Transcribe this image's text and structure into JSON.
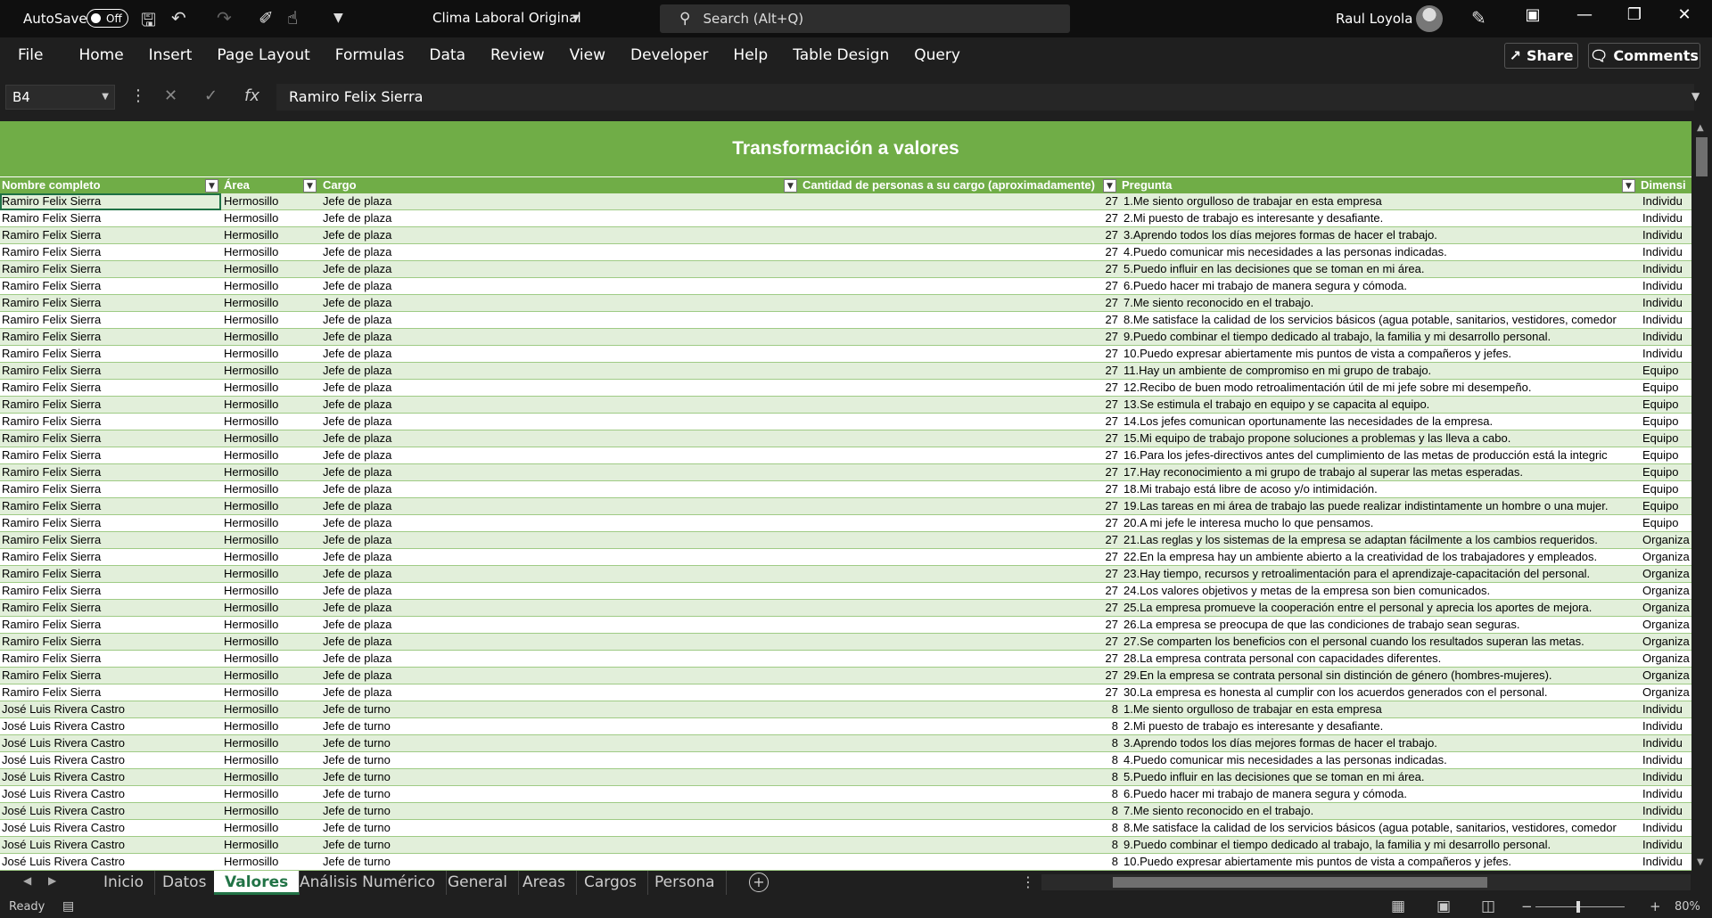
{
  "titlebar": {
    "autosave_label": "AutoSave",
    "autosave_state": "Off",
    "doc_title": "Clima Laboral Original",
    "search_placeholder": "Search (Alt+Q)",
    "user_name": "Raul Loyola"
  },
  "menu": [
    "File",
    "Home",
    "Insert",
    "Page Layout",
    "Formulas",
    "Data",
    "Review",
    "View",
    "Developer",
    "Help",
    "Table Design",
    "Query"
  ],
  "share_label": "Share",
  "comments_label": "Comments",
  "formula": {
    "cell_ref": "B4",
    "content": "Ramiro Felix Sierra"
  },
  "sheet": {
    "title": "Transformación a valores",
    "headers": [
      "Nombre completo",
      "Área",
      "Cargo",
      "Cantidad de personas a su cargo (aproximadamente)",
      "Pregunta",
      "Dimensi"
    ],
    "rows": [
      [
        "Ramiro Felix Sierra",
        "Hermosillo",
        "Jefe de plaza",
        "27",
        "1.Me siento orgulloso de trabajar en esta empresa",
        "Individu"
      ],
      [
        "Ramiro Felix Sierra",
        "Hermosillo",
        "Jefe de plaza",
        "27",
        "2.Mi puesto de trabajo es interesante y desafiante.",
        "Individu"
      ],
      [
        "Ramiro Felix Sierra",
        "Hermosillo",
        "Jefe de plaza",
        "27",
        "3.Aprendo todos los días mejores formas de hacer el trabajo.",
        "Individu"
      ],
      [
        "Ramiro Felix Sierra",
        "Hermosillo",
        "Jefe de plaza",
        "27",
        "4.Puedo comunicar mis necesidades a las personas indicadas.",
        "Individu"
      ],
      [
        "Ramiro Felix Sierra",
        "Hermosillo",
        "Jefe de plaza",
        "27",
        "5.Puedo influir en las decisiones que se toman en mi área.",
        "Individu"
      ],
      [
        "Ramiro Felix Sierra",
        "Hermosillo",
        "Jefe de plaza",
        "27",
        "6.Puedo hacer mi trabajo de manera segura y cómoda.",
        "Individu"
      ],
      [
        "Ramiro Felix Sierra",
        "Hermosillo",
        "Jefe de plaza",
        "27",
        "7.Me siento reconocido en el trabajo.",
        "Individu"
      ],
      [
        "Ramiro Felix Sierra",
        "Hermosillo",
        "Jefe de plaza",
        "27",
        "8.Me satisface la calidad de los servicios básicos (agua potable, sanitarios, vestidores, comedor",
        "Individu"
      ],
      [
        "Ramiro Felix Sierra",
        "Hermosillo",
        "Jefe de plaza",
        "27",
        "9.Puedo combinar el tiempo dedicado al trabajo, la familia y mi desarrollo personal.",
        "Individu"
      ],
      [
        "Ramiro Felix Sierra",
        "Hermosillo",
        "Jefe de plaza",
        "27",
        "10.Puedo expresar abiertamente mis puntos de vista a compañeros y jefes.",
        "Individu"
      ],
      [
        "Ramiro Felix Sierra",
        "Hermosillo",
        "Jefe de plaza",
        "27",
        "11.Hay un ambiente de compromiso en mi grupo de trabajo.",
        "Equipo"
      ],
      [
        "Ramiro Felix Sierra",
        "Hermosillo",
        "Jefe de plaza",
        "27",
        "12.Recibo de buen modo retroalimentación útil de mi jefe sobre mi desempeño.",
        "Equipo"
      ],
      [
        "Ramiro Felix Sierra",
        "Hermosillo",
        "Jefe de plaza",
        "27",
        "13.Se estimula el trabajo en equipo y se capacita al equipo.",
        "Equipo"
      ],
      [
        "Ramiro Felix Sierra",
        "Hermosillo",
        "Jefe de plaza",
        "27",
        "14.Los jefes comunican oportunamente las necesidades de la empresa.",
        "Equipo"
      ],
      [
        "Ramiro Felix Sierra",
        "Hermosillo",
        "Jefe de plaza",
        "27",
        "15.Mi equipo de trabajo propone soluciones a problemas y las lleva a cabo.",
        "Equipo"
      ],
      [
        "Ramiro Felix Sierra",
        "Hermosillo",
        "Jefe de plaza",
        "27",
        "16.Para los jefes-directivos antes del cumplimiento de las metas de producción está la integric",
        "Equipo"
      ],
      [
        "Ramiro Felix Sierra",
        "Hermosillo",
        "Jefe de plaza",
        "27",
        "17.Hay reconocimiento a mi grupo de trabajo al superar las metas esperadas.",
        "Equipo"
      ],
      [
        "Ramiro Felix Sierra",
        "Hermosillo",
        "Jefe de plaza",
        "27",
        "18.Mi trabajo está libre de acoso y/o intimidación.",
        "Equipo"
      ],
      [
        "Ramiro Felix Sierra",
        "Hermosillo",
        "Jefe de plaza",
        "27",
        "19.Las tareas en mi área de trabajo las puede realizar indistintamente un hombre o una mujer.",
        "Equipo"
      ],
      [
        "Ramiro Felix Sierra",
        "Hermosillo",
        "Jefe de plaza",
        "27",
        "20.A mi jefe le interesa mucho lo que pensamos.",
        "Equipo"
      ],
      [
        "Ramiro Felix Sierra",
        "Hermosillo",
        "Jefe de plaza",
        "27",
        "21.Las reglas y los sistemas de la empresa se adaptan fácilmente a los cambios requeridos.",
        "Organiza"
      ],
      [
        "Ramiro Felix Sierra",
        "Hermosillo",
        "Jefe de plaza",
        "27",
        "22.En la empresa hay un ambiente abierto a la creatividad de los trabajadores y empleados.",
        "Organiza"
      ],
      [
        "Ramiro Felix Sierra",
        "Hermosillo",
        "Jefe de plaza",
        "27",
        "23.Hay tiempo, recursos y retroalimentación para el aprendizaje-capacitación del personal.",
        "Organiza"
      ],
      [
        "Ramiro Felix Sierra",
        "Hermosillo",
        "Jefe de plaza",
        "27",
        "24.Los valores objetivos y metas de la empresa son bien comunicados.",
        "Organiza"
      ],
      [
        "Ramiro Felix Sierra",
        "Hermosillo",
        "Jefe de plaza",
        "27",
        "25.La empresa promueve la cooperación entre el personal y aprecia los aportes de mejora.",
        "Organiza"
      ],
      [
        "Ramiro Felix Sierra",
        "Hermosillo",
        "Jefe de plaza",
        "27",
        "26.La empresa se preocupa de que las condiciones de trabajo sean seguras.",
        "Organiza"
      ],
      [
        "Ramiro Felix Sierra",
        "Hermosillo",
        "Jefe de plaza",
        "27",
        "27.Se comparten los beneficios con el personal cuando los resultados superan las metas.",
        "Organiza"
      ],
      [
        "Ramiro Felix Sierra",
        "Hermosillo",
        "Jefe de plaza",
        "27",
        "28.La empresa contrata personal con capacidades diferentes.",
        "Organiza"
      ],
      [
        "Ramiro Felix Sierra",
        "Hermosillo",
        "Jefe de plaza",
        "27",
        "29.En la empresa se contrata personal sin distinción de género (hombres-mujeres).",
        "Organiza"
      ],
      [
        "Ramiro Felix Sierra",
        "Hermosillo",
        "Jefe de plaza",
        "27",
        "30.La empresa es honesta al cumplir con los acuerdos generados con el personal.",
        "Organiza"
      ],
      [
        "José Luis Rivera Castro",
        "Hermosillo",
        "Jefe de turno",
        "8",
        "1.Me siento orgulloso de trabajar en esta empresa",
        "Individu"
      ],
      [
        "José Luis Rivera Castro",
        "Hermosillo",
        "Jefe de turno",
        "8",
        "2.Mi puesto de trabajo es interesante y desafiante.",
        "Individu"
      ],
      [
        "José Luis Rivera Castro",
        "Hermosillo",
        "Jefe de turno",
        "8",
        "3.Aprendo todos los días mejores formas de hacer el trabajo.",
        "Individu"
      ],
      [
        "José Luis Rivera Castro",
        "Hermosillo",
        "Jefe de turno",
        "8",
        "4.Puedo comunicar mis necesidades a las personas indicadas.",
        "Individu"
      ],
      [
        "José Luis Rivera Castro",
        "Hermosillo",
        "Jefe de turno",
        "8",
        "5.Puedo influir en las decisiones que se toman en mi área.",
        "Individu"
      ],
      [
        "José Luis Rivera Castro",
        "Hermosillo",
        "Jefe de turno",
        "8",
        "6.Puedo hacer mi trabajo de manera segura y cómoda.",
        "Individu"
      ],
      [
        "José Luis Rivera Castro",
        "Hermosillo",
        "Jefe de turno",
        "8",
        "7.Me siento reconocido en el trabajo.",
        "Individu"
      ],
      [
        "José Luis Rivera Castro",
        "Hermosillo",
        "Jefe de turno",
        "8",
        "8.Me satisface la calidad de los servicios básicos (agua potable, sanitarios, vestidores, comedor",
        "Individu"
      ],
      [
        "José Luis Rivera Castro",
        "Hermosillo",
        "Jefe de turno",
        "8",
        "9.Puedo combinar el tiempo dedicado al trabajo, la familia y mi desarrollo personal.",
        "Individu"
      ],
      [
        "José Luis Rivera Castro",
        "Hermosillo",
        "Jefe de turno",
        "8",
        "10.Puedo expresar abiertamente mis puntos de vista a compañeros y jefes.",
        "Individu"
      ]
    ]
  },
  "tabs": [
    "Inicio",
    "Datos",
    "Valores",
    "Análisis Numérico",
    "General",
    "Areas",
    "Cargos",
    "Persona"
  ],
  "active_tab": "Valores",
  "status": {
    "ready": "Ready",
    "zoom": "80%"
  },
  "colors": {
    "accent": "#70ad47",
    "band": "#e2efda",
    "excel_green": "#217346"
  }
}
